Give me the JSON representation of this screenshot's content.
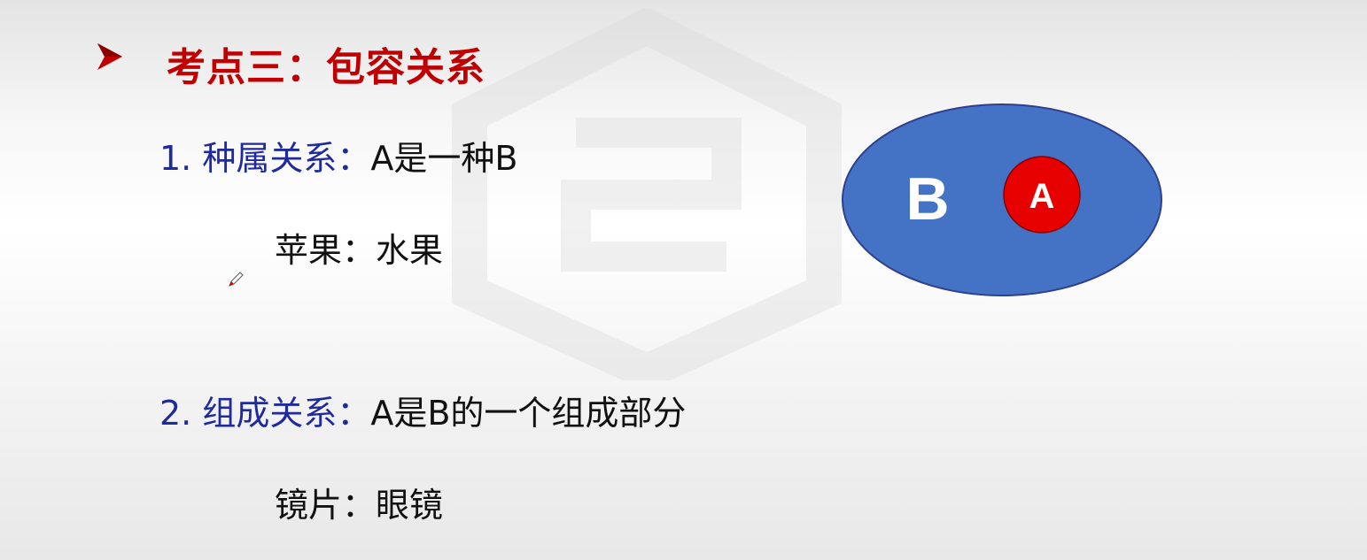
{
  "heading": {
    "text": "考点三：包容关系",
    "color": "#c00000"
  },
  "items": [
    {
      "label": "1. 种属关系：",
      "description": "A是一种B",
      "example": "苹果：水果"
    },
    {
      "label": "2. 组成关系：",
      "description": "A是B的一个组成部分",
      "example": "镜片：眼镜"
    }
  ],
  "diagram": {
    "outer_label": "B",
    "inner_label": "A",
    "outer_color": "#4472c4",
    "inner_color": "#e60000"
  },
  "icons": {
    "bullet": "arrowhead-bullet-icon",
    "pointer": "pen-cursor-icon"
  }
}
